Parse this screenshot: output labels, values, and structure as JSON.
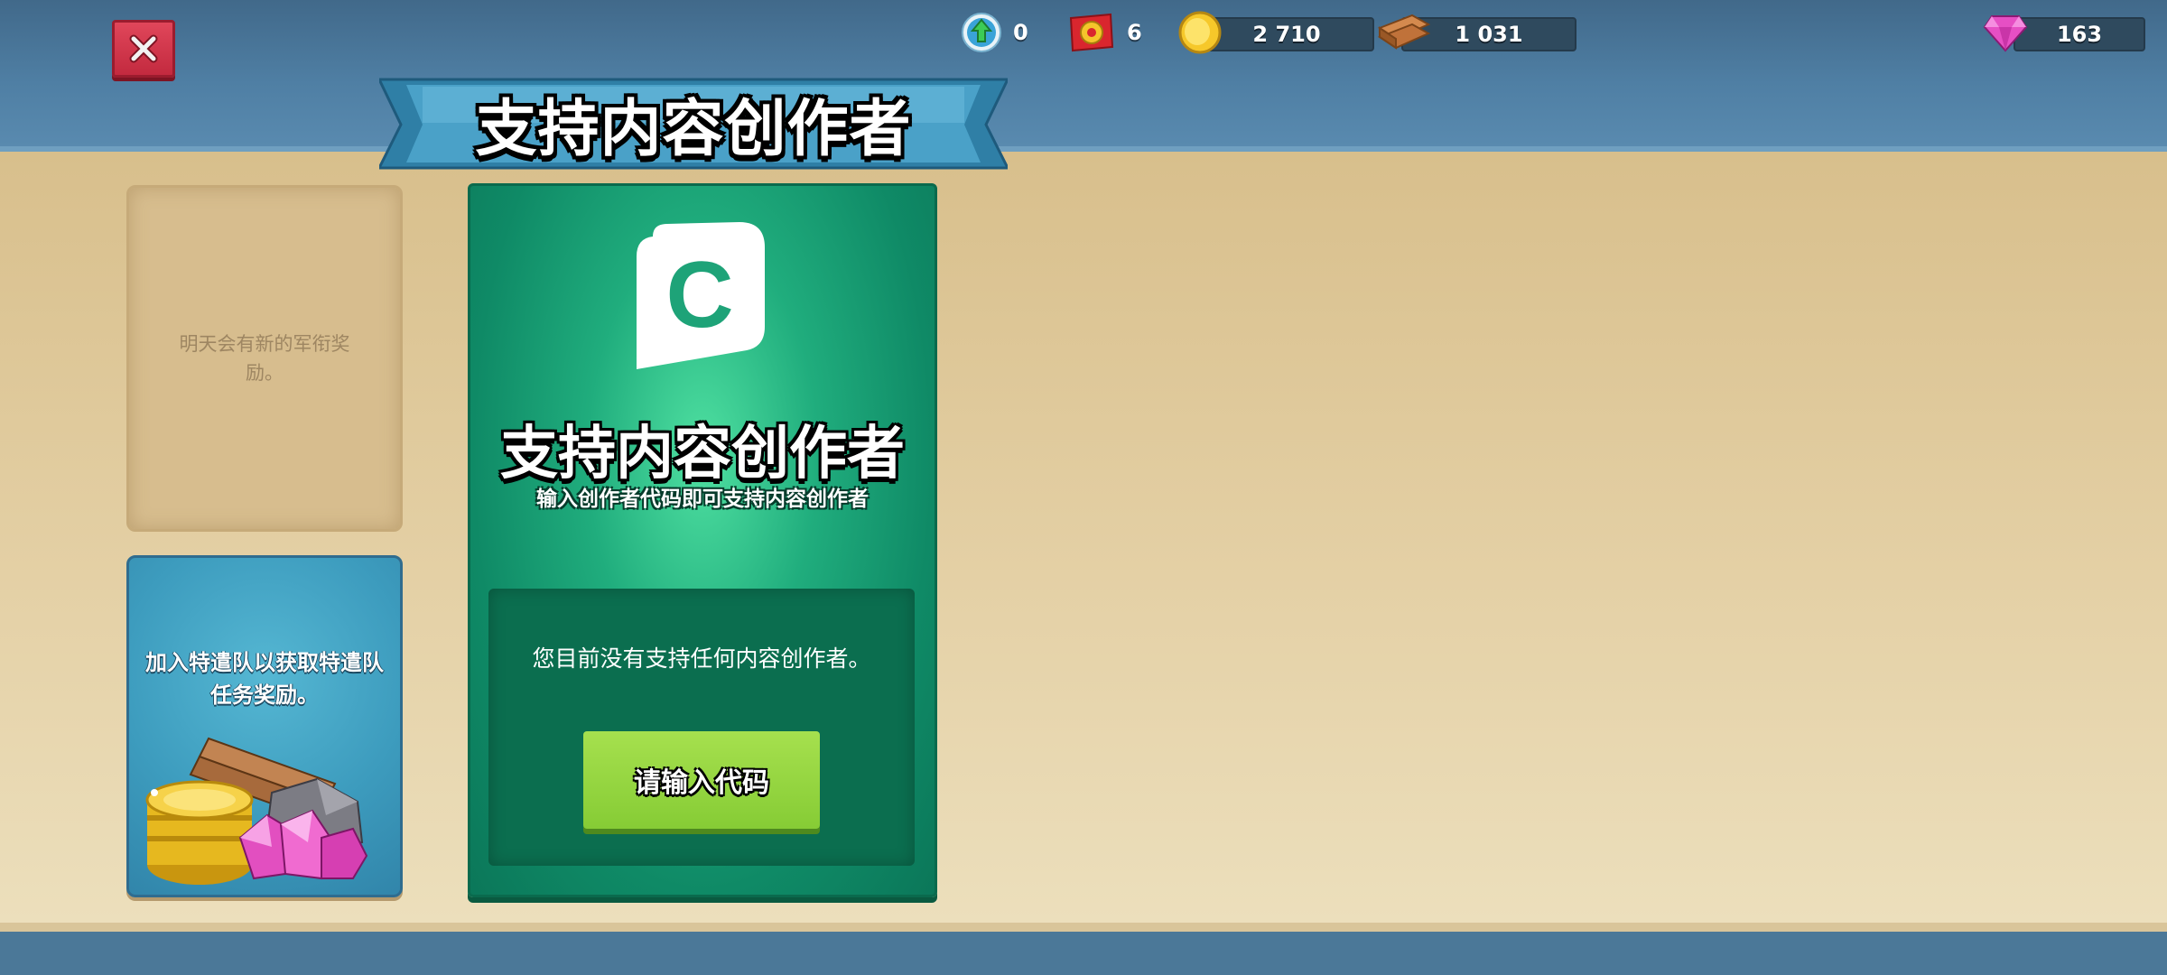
{
  "header": {
    "resources": {
      "upgrade": "0",
      "tokens": "6",
      "gold": "2 710",
      "wood": "1 031",
      "gems": "163"
    }
  },
  "page": {
    "title": "支持内容创作者"
  },
  "side_cards": {
    "daily_message": "明天会有新的军衔奖励。",
    "squad_message": "加入特遣队以获取特遣队任务奖励。"
  },
  "creator_card": {
    "logo_letter": "C",
    "title": "支持内容创作者",
    "subtitle": "输入创作者代码即可支持内容创作者",
    "status_message": "您目前没有支持任何内容创作者。",
    "button_label": "请输入代码"
  },
  "colors": {
    "top_bar": "#4f7fa4",
    "creator_green": "#20ad7d",
    "button_green": "#86cc35",
    "close_red": "#c32a3f"
  }
}
